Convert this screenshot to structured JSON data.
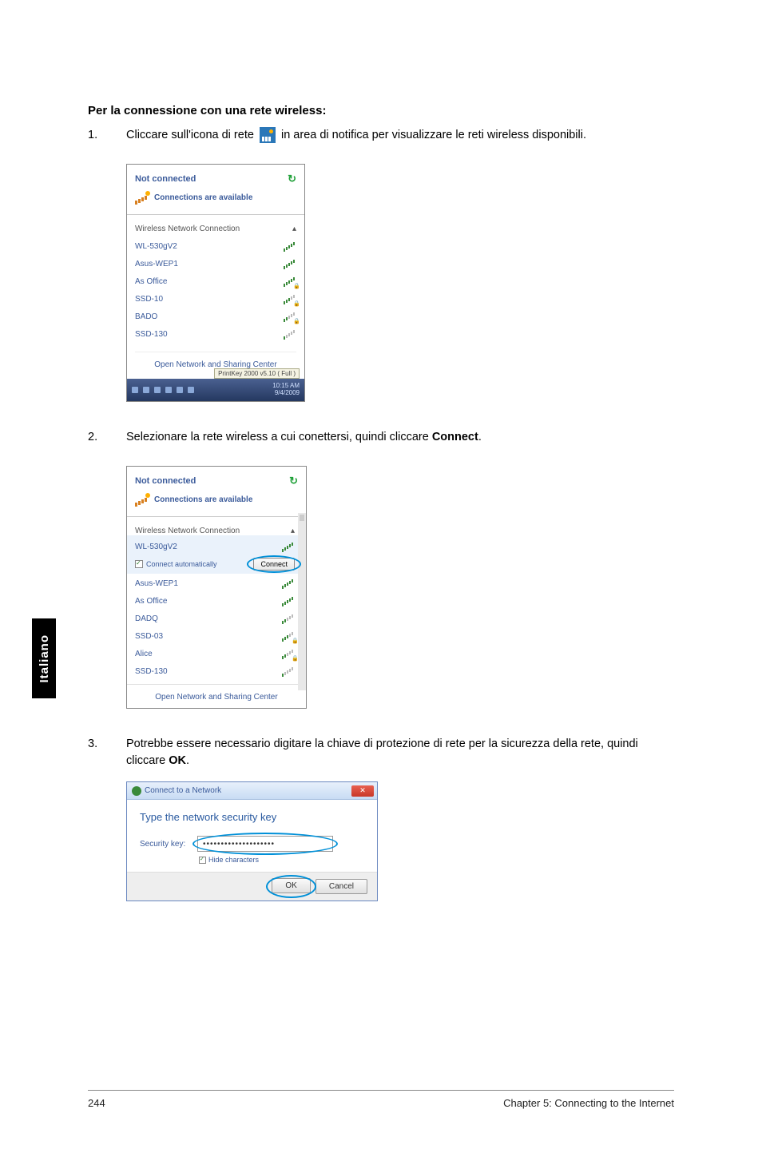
{
  "heading": "Per la connessione con una rete wireless:",
  "step1": {
    "num": "1.",
    "text_before": "Cliccare sull'icona di rete ",
    "text_after": " in area di notifica per visualizzare le reti wireless disponibili."
  },
  "step2": {
    "num": "2.",
    "text_before": "Selezionare la rete wireless a cui conettersi, quindi cliccare ",
    "bold": "Connect",
    "text_after": "."
  },
  "step3": {
    "num": "3.",
    "text_before": "Potrebbe essere necessario digitare la chiave di protezione di rete per la sicurezza della rete, quindi cliccare ",
    "bold": "OK",
    "text_after": "."
  },
  "popup1": {
    "not_connected": "Not connected",
    "connections_available": "Connections are available",
    "wireless_header": "Wireless Network Connection",
    "networks": [
      "WL-530gV2",
      "Asus-WEP1",
      "As Office",
      "SSD-10",
      "BADO",
      "SSD-130"
    ],
    "open_center": "Open Network and Sharing Center",
    "taskbar_tip": "PrintKey 2000 v5.10 ( Full )",
    "time": "10:15 AM",
    "date": "9/4/2009"
  },
  "popup2": {
    "not_connected": "Not connected",
    "connections_available": "Connections are available",
    "wireless_header": "Wireless Network Connection",
    "selected": "WL-530gV2",
    "connect_auto": "Connect automatically",
    "connect_btn": "Connect",
    "networks": [
      "Asus-WEP1",
      "As Office",
      "DADQ",
      "SSD-03",
      "Alice",
      "SSD-130"
    ],
    "open_center": "Open Network and Sharing Center"
  },
  "dialog": {
    "title": "Connect to a Network",
    "heading": "Type the network security key",
    "key_label": "Security key:",
    "key_value": "••••••••••••••••••••",
    "hide_chars": "Hide characters",
    "ok": "OK",
    "cancel": "Cancel"
  },
  "side_tab": "Italiano",
  "footer": {
    "page": "244",
    "chapter": "Chapter 5: Connecting to the Internet"
  }
}
